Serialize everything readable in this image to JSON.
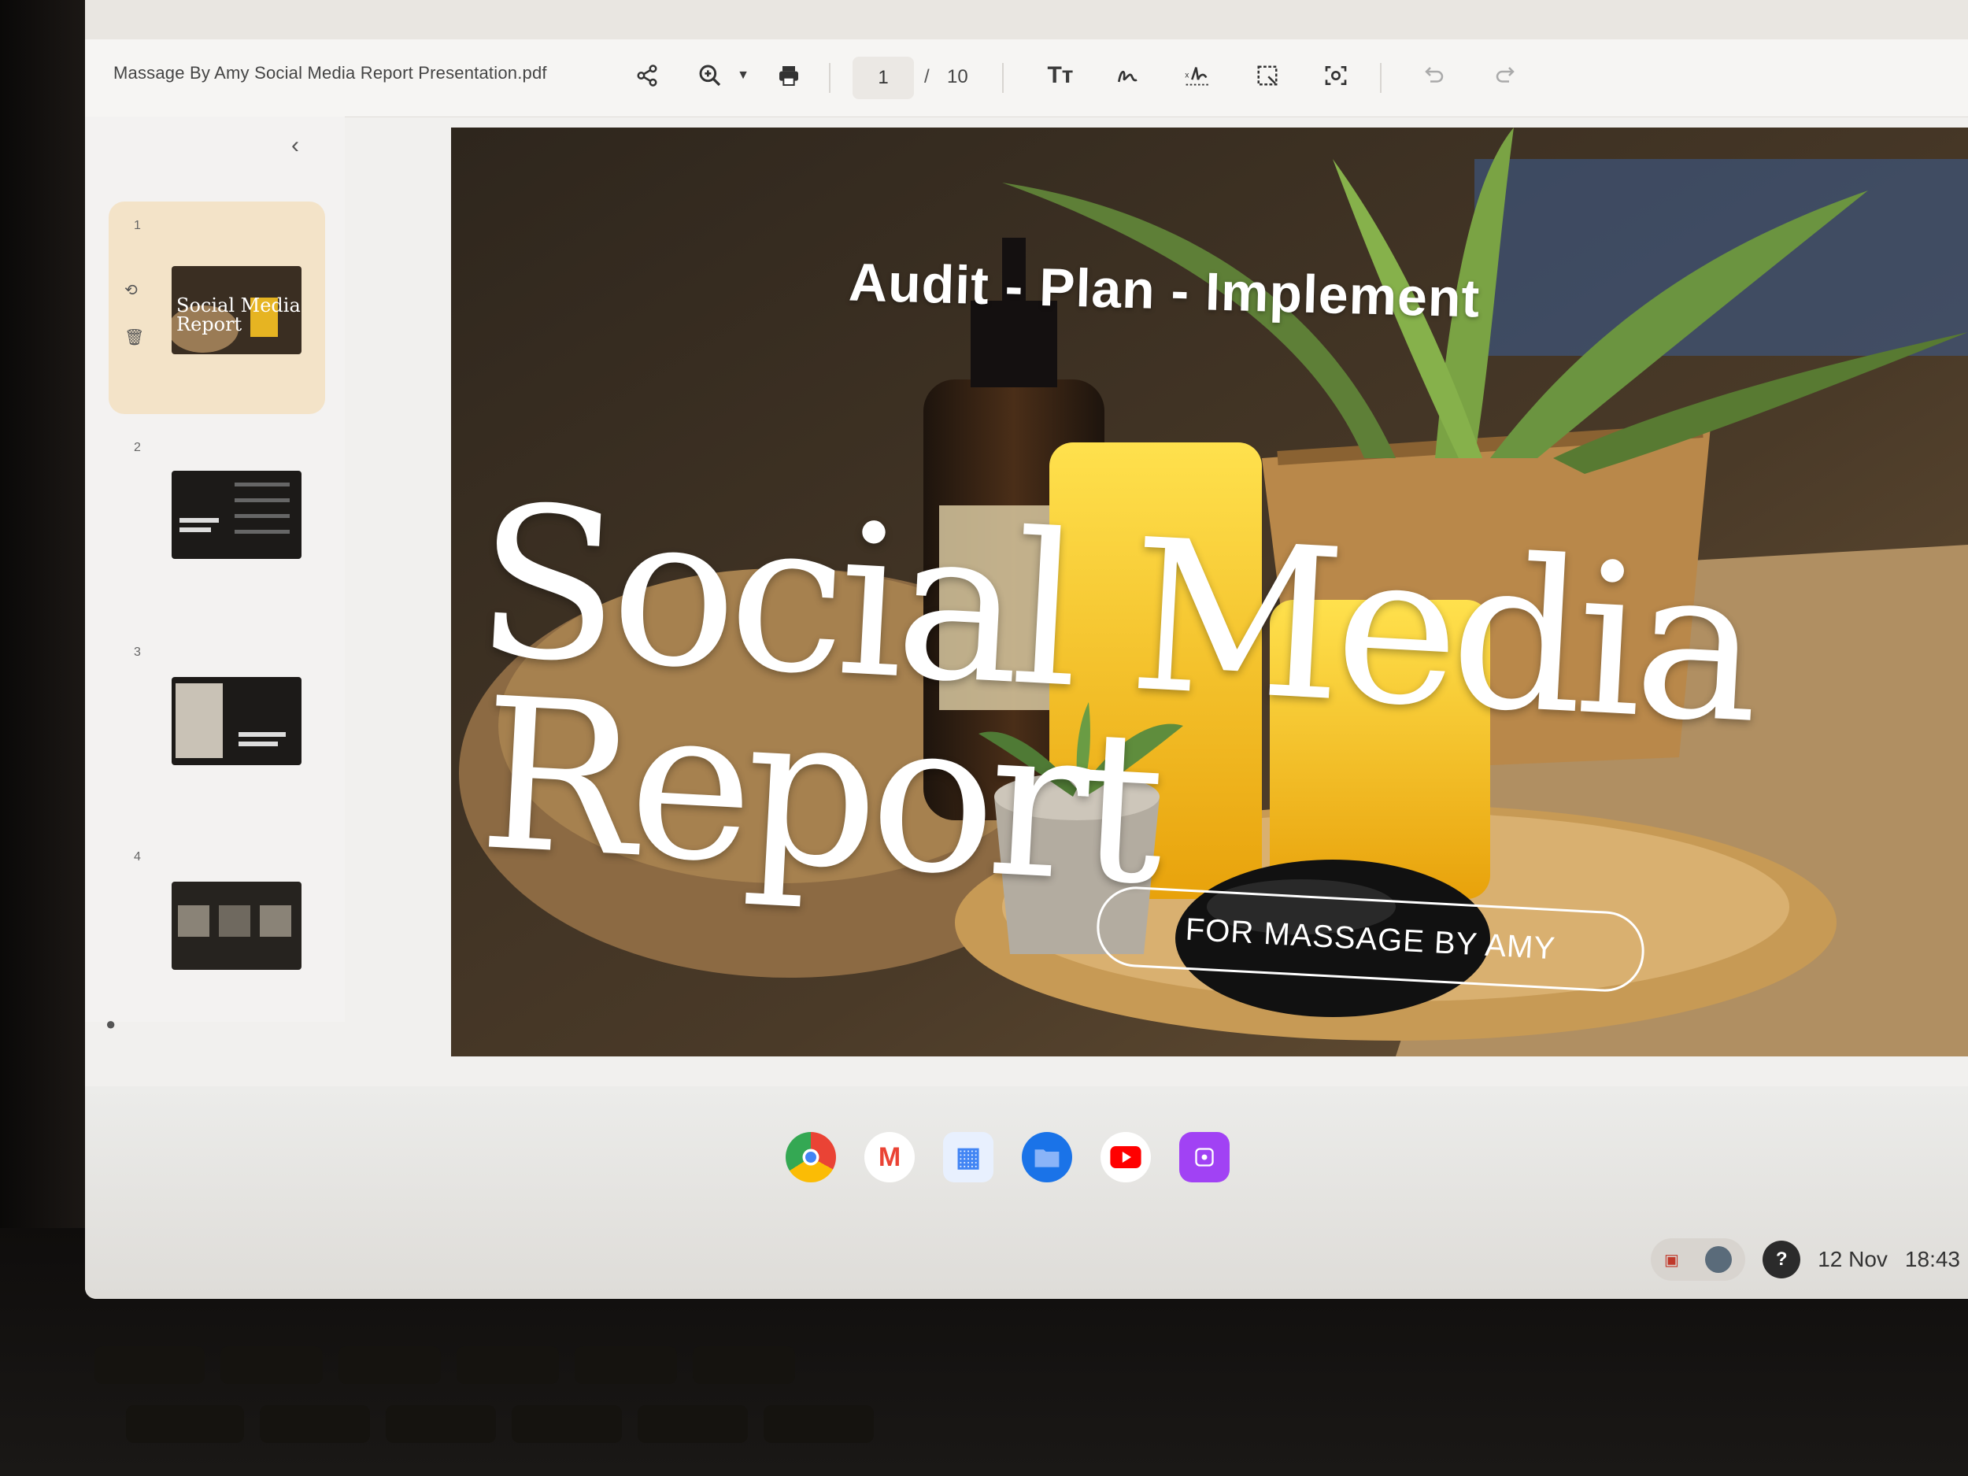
{
  "window": {
    "document_title": "Massage By Amy Social Media Report Presentation.pdf"
  },
  "toolbar": {
    "share_icon": "share-icon",
    "zoom_icon": "zoom-in-icon",
    "print_icon": "print-icon",
    "current_page": "1",
    "page_separator": "/",
    "total_pages": "10",
    "tools": [
      "text-tool-icon",
      "draw-icon",
      "signature-icon",
      "select-area-icon",
      "screenshot-icon",
      "undo-icon",
      "redo-icon"
    ]
  },
  "sidebar": {
    "collapse_icon": "chevron-left-icon",
    "thumbnails": [
      {
        "number": "1",
        "active": true
      },
      {
        "number": "2",
        "active": false
      },
      {
        "number": "3",
        "active": false
      },
      {
        "number": "4",
        "active": false
      }
    ]
  },
  "slide": {
    "tagline": "Audit - Plan - Implement",
    "title_line1": "Social Media",
    "title_line2": "Report",
    "pill_label": "FOR MASSAGE BY AMY"
  },
  "shelf": {
    "apps": [
      {
        "name": "chrome-icon",
        "color": "#34a853"
      },
      {
        "name": "gmail-icon",
        "color": "#ea4335"
      },
      {
        "name": "docs-icon",
        "color": "#4285f4"
      },
      {
        "name": "files-icon",
        "color": "#1a73e8"
      },
      {
        "name": "youtube-icon",
        "color": "#ff0000"
      },
      {
        "name": "gallery-icon",
        "color": "#a142f4"
      }
    ],
    "date": "12 Nov",
    "time": "18:43"
  }
}
